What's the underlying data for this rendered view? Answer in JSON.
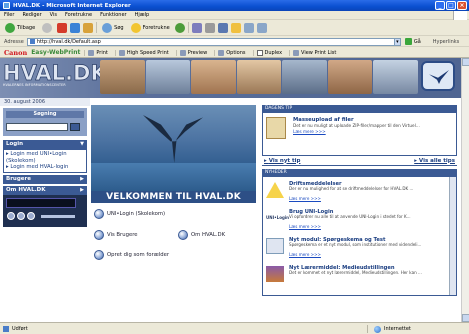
{
  "window": {
    "title": "HVAL.DK - Microsoft Internet Explorer"
  },
  "menu": [
    "Filer",
    "Rediger",
    "Vis",
    "Foretrukne",
    "Funktioner",
    "Hjælp"
  ],
  "toolbar": {
    "back_label": "Tilbage",
    "search_label": "Søg",
    "favorites_label": "Foretrukne"
  },
  "address": {
    "label": "Adresse",
    "url": "http://hval.dk/Default.asp",
    "go_label": "Gå",
    "links_label": "Hyperlinks"
  },
  "linksbar": {
    "brand": "Canon",
    "product": "Easy-WebPrint",
    "print": "Print",
    "high_speed": "High Speed Print",
    "preview": "Preview",
    "options": "Options",
    "duplex": "Duplex",
    "view_print_list": "View Print List"
  },
  "site": {
    "logo": "HVAL.DK",
    "logo_sub": "HVALERNES INFORMATIONSCENTER",
    "date": "30. august 2006"
  },
  "sidebar": {
    "search_title": "Søgning",
    "login_title": "Login",
    "login_links": [
      "Login med UNI•Login (Skolekom)",
      "Login med HVAL-login"
    ],
    "users_title": "Brugere",
    "about_title": "Om HVAL.DK"
  },
  "center": {
    "welcome": "VELKOMMEN TIL HVAL.DK",
    "uni_login": "UNI•Login (Skolekom)",
    "show_users": "Vis Brugere",
    "about": "Om HVAL.DK",
    "create_parent": "Opret dig som forælder"
  },
  "tips": {
    "header": "DAGENS TIP",
    "title": "Masseupload af filer",
    "text": "Det er nu muligt at uploade ZIP-filer/mapper til den Virtuel...",
    "more": "Læs mere >>>",
    "prev": "Vis nyt tip",
    "all": "Vis alle tips"
  },
  "news": {
    "header": "NYHEDER",
    "items": [
      {
        "title": "Driftsmeddelelser",
        "text": "Der er nu mulighed for at se driftmeddelelser for HVAL.DK ...",
        "more": "Læs mere >>>"
      },
      {
        "title": "Brug UNI-Login",
        "text": "Vi opfordrer nu alle til at anvende UNI-Login i stedet for K...",
        "more": "Læs mere >>>"
      },
      {
        "title": "Nyt modul: Spørgeskema og Test",
        "text": "Spørgeskema er et nyt modul, som institutioner med videndeli...",
        "more": "Læs mere >>>"
      },
      {
        "title": "Nyt Lærermiddel: Medieudstillingen",
        "text": "Det er kommet et nyt lærermiddel, Medieudstillingen. Her kan ...",
        "more": ""
      }
    ],
    "uni_login_logo": "UNI•Login"
  },
  "status": {
    "text": "Udført",
    "zone": "Internettet"
  },
  "colors": {
    "xp_blue": "#0a4fd0",
    "site_navy": "#3b5a94",
    "canon_red": "#d0121a"
  }
}
